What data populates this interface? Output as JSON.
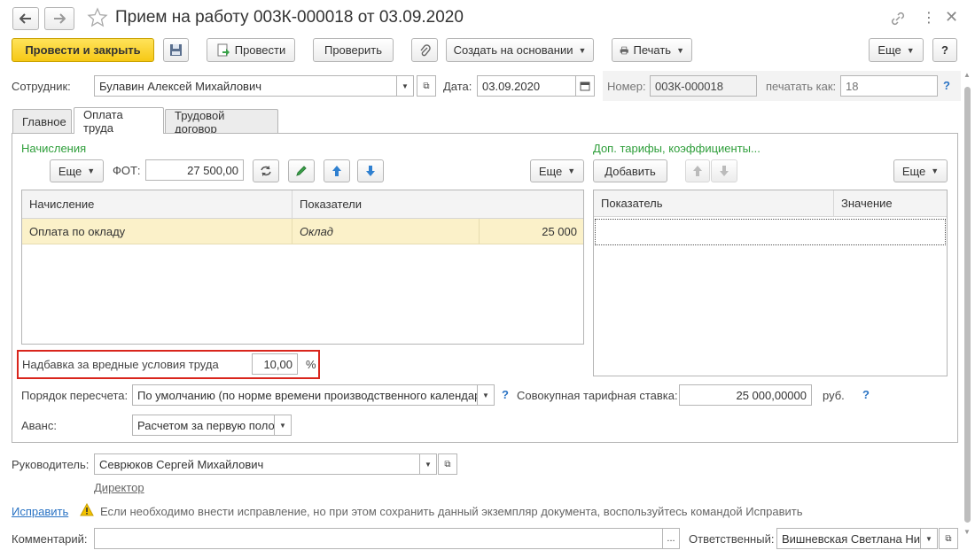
{
  "title": "Прием на работу 003К-000018 от 03.09.2020",
  "toolbar": {
    "post_close": "Провести и закрыть",
    "post": "Провести",
    "check": "Проверить",
    "create_based": "Создать на основании",
    "print": "Печать",
    "more": "Еще",
    "help": "?"
  },
  "header": {
    "employee_label": "Сотрудник:",
    "employee_value": "Булавин Алексей Михайлович",
    "date_label": "Дата:",
    "date_value": "03.09.2020",
    "number_label": "Номер:",
    "number_value": "003К-000018",
    "print_as_label": "печатать как:",
    "print_as_placeholder": "18",
    "help": "?"
  },
  "tabs": [
    "Главное",
    "Оплата труда",
    "Трудовой договор"
  ],
  "accruals": {
    "section_title": "Начисления",
    "more": "Еще",
    "fot_label": "ФОТ:",
    "fot_value": "27 500,00",
    "more_right": "Еще",
    "columns": [
      "Начисление",
      "Показатели"
    ],
    "rows": [
      {
        "name": "Оплата по окладу",
        "indicator": "Оклад",
        "value": "25 000"
      }
    ]
  },
  "tariffs": {
    "section_title": "Доп. тарифы, коэффициенты...",
    "add": "Добавить",
    "more": "Еще",
    "columns": [
      "Показатель",
      "Значение"
    ]
  },
  "bonus": {
    "label": "Надбавка за вредные условия труда",
    "value": "10,00",
    "unit": "%"
  },
  "recalc": {
    "label": "Порядок пересчета:",
    "value": "По умолчанию (по норме времени производственного календаря)",
    "help": "?"
  },
  "rate": {
    "label": "Совокупная тарифная ставка:",
    "value": "25 000,00000",
    "unit": "руб.",
    "help": "?"
  },
  "advance": {
    "label": "Аванс:",
    "value": "Расчетом за первую половину месяца"
  },
  "manager": {
    "label": "Руководитель:",
    "value": "Севрюков Сергей Михайлович",
    "position": "Директор"
  },
  "fix": {
    "link": "Исправить",
    "note": "Если необходимо внести исправление, но при этом сохранить данный экземпляр документа, воспользуйтесь командой Исправить"
  },
  "footer": {
    "comment_label": "Комментарий:",
    "comment_value": "",
    "ellipsis": "...",
    "responsible_label": "Ответственный:",
    "responsible_value": "Вишневская Светлана Николаевна"
  },
  "colors": {
    "accent_yellow": "#f6c815",
    "row_highlight": "#fbf1c9",
    "section_green": "#2e9e3a",
    "link_blue": "#2a73c4",
    "highlight_red": "#d9251c"
  }
}
